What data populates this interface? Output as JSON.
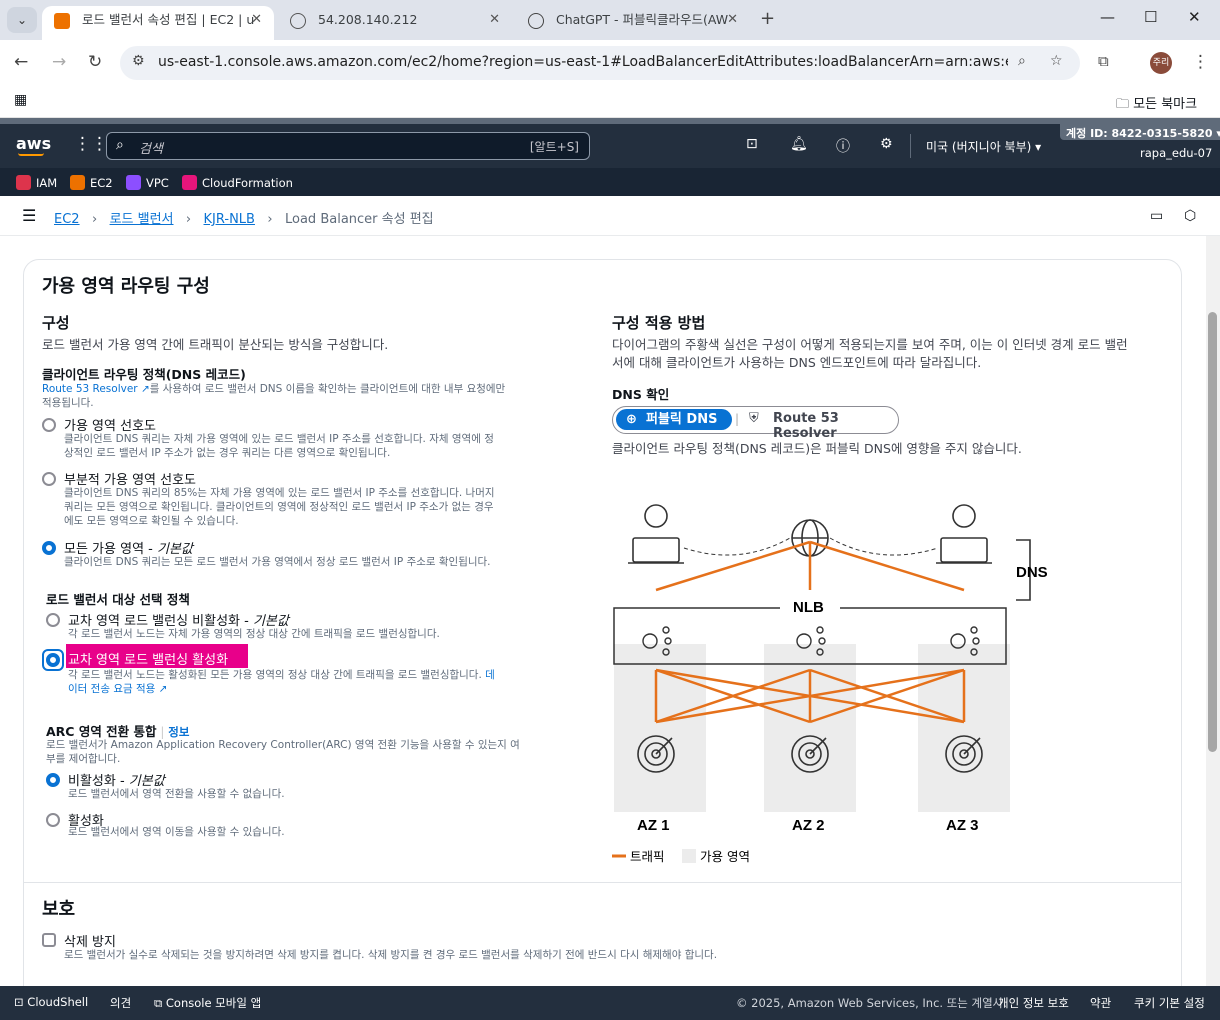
{
  "browser": {
    "tabs": [
      {
        "title": "로드 밸런서 속성 편집 | EC2 | u"
      },
      {
        "title": "54.208.140.212"
      },
      {
        "title": "ChatGPT - 퍼블릭클라우드(AW"
      }
    ],
    "url": "us-east-1.console.aws.amazon.com/ec2/home?region=us-east-1#LoadBalancerEditAttributes:loadBalancerArn=arn:aws:elasticloadbal...",
    "profile": "주리",
    "bookmarks_label": "모든 북마크"
  },
  "aws": {
    "logo": "aws",
    "search_placeholder": "검색",
    "search_shortcut": "[알트+S]",
    "region": "미국 (버지니아 북부)",
    "account_id": "계정 ID: 8422-0315-5820",
    "user": "rapa_edu-07",
    "favorites": [
      {
        "label": "IAM",
        "color": "#dd344c"
      },
      {
        "label": "EC2",
        "color": "#ed7100"
      },
      {
        "label": "VPC",
        "color": "#8c4fff"
      },
      {
        "label": "CloudFormation",
        "color": "#e7157b"
      }
    ]
  },
  "breadcrumb": {
    "items": [
      "EC2",
      "로드 밸런서",
      "KJR-NLB"
    ],
    "current": "Load Balancer 속성 편집"
  },
  "section": {
    "title": "가용 영역 라우팅 구성",
    "config_title": "구성",
    "config_desc": "로드 밸런서 가용 영역 간에 트래픽이 분산되는 방식을 구성합니다.",
    "dns_policy_label": "클라이언트 라우팅 정책(DNS 레코드)",
    "dns_policy_link": "Route 53 Resolver",
    "dns_policy_desc1": "를 사용하여 로드 밸런서 DNS 이름을 확인하는 클라이언트에 대한 내부 요청에만",
    "dns_policy_desc2": "적용됩니다.",
    "opt1_label": "가용 영역 선호도",
    "opt1_desc1": "클라이언트 DNS 쿼리는 자체 가용 영역에 있는 로드 밸런서 IP 주소를 선호합니다. 자체 영역에 정",
    "opt1_desc2": "상적인 로드 밸런서 IP 주소가 없는 경우 쿼리는 다른 영역으로 확인됩니다.",
    "opt2_label": "부분적 가용 영역 선호도",
    "opt2_desc1": "클라이언트 DNS 쿼리의 85%는 자체 가용 영역에 있는 로드 밸런서 IP 주소를 선호합니다. 나머지",
    "opt2_desc2": "쿼리는 모든 영역으로 확인됩니다. 클라이언트의 영역에 정상적인 로드 밸런서 IP 주소가 없는 경우",
    "opt2_desc3": "에도 모든 영역으로 확인될 수 있습니다.",
    "opt3_label": "모든 가용 영역 - ",
    "opt3_default": "기본값",
    "opt3_desc": "클라이언트 DNS 쿼리는 모든 로드 밸런서 가용 영역에서 정상 로드 밸런서 IP 주소로 확인됩니다.",
    "target_label": "로드 밸런서 대상 선택 정책",
    "cz_off_label": "교차 영역 로드 밸런싱 비활성화 - ",
    "cz_off_default": "기본값",
    "cz_off_desc": "각 로드 밸런서 노드는 자체 가용 영역의 정상 대상 간에 트래픽을 로드 밸런싱합니다.",
    "cz_on_label": "교차 영역 로드 밸런싱 활성화",
    "cz_on_desc": "각 로드 밸런서 노드는 활성화된 모든 가용 영역의 정상 대상 간에 트래픽을 로드 밸런싱합니다.",
    "cz_on_link1": "데",
    "cz_on_link2": "이터 전송 요금 적용",
    "arc_label": "ARC 영역 전환 통합",
    "arc_info": "정보",
    "arc_desc1": "로드 밸런서가 Amazon Application Recovery Controller(ARC) 영역 전환 기능을 사용할 수 있는지 여",
    "arc_desc2": "부를 제어합니다.",
    "arc_off_label": "비활성화 - ",
    "arc_off_default": "기본값",
    "arc_off_desc": "로드 밸런서에서 영역 전환을 사용할 수 없습니다.",
    "arc_on_label": "활성화",
    "arc_on_desc": "로드 밸런서에서 영역 이동을 사용할 수 있습니다.",
    "apply_title": "구성 적용 방법",
    "apply_desc1": "다이어그램의 주황색 실선은 구성이 어떻게 적용되는지를 보여 주며, 이는 이 인터넷 경계 로드 밸런",
    "apply_desc2": "서에 대해 클라이언트가 사용하는 DNS 엔드포인트에 따라 달라집니다.",
    "dns_check": "DNS 확인",
    "seg_public": "퍼블릭 DNS",
    "seg_resolver": "Route 53 Resolver",
    "dns_note": "클라이언트 라우팅 정책(DNS 레코드)은 퍼블릭 DNS에 영향을 주지 않습니다.",
    "diagram": {
      "dns": "DNS",
      "nlb": "NLB",
      "az": [
        "AZ 1",
        "AZ 2",
        "AZ 3"
      ],
      "legend_traffic": "트래픽",
      "legend_az": "가용 영역",
      "traffic_color": "#e5711b"
    },
    "protect_title": "보호",
    "delete_label": "삭제 방지",
    "delete_desc": "로드 밸런서가 실수로 삭제되는 것을 방지하려면 삭제 방지를 켭니다. 삭제 방지를 켠 경우 로드 밸런서를 삭제하기 전에 반드시 다시 해제해야 합니다."
  },
  "footer": {
    "cloudshell": "CloudShell",
    "feedback": "의견",
    "mobile": "Console 모바일 앱",
    "copyright": "© 2025, Amazon Web Services, Inc. 또는 계열사.",
    "privacy": "개인 정보 보호",
    "terms": "약관",
    "cookie": "쿠키 기본 설정"
  }
}
